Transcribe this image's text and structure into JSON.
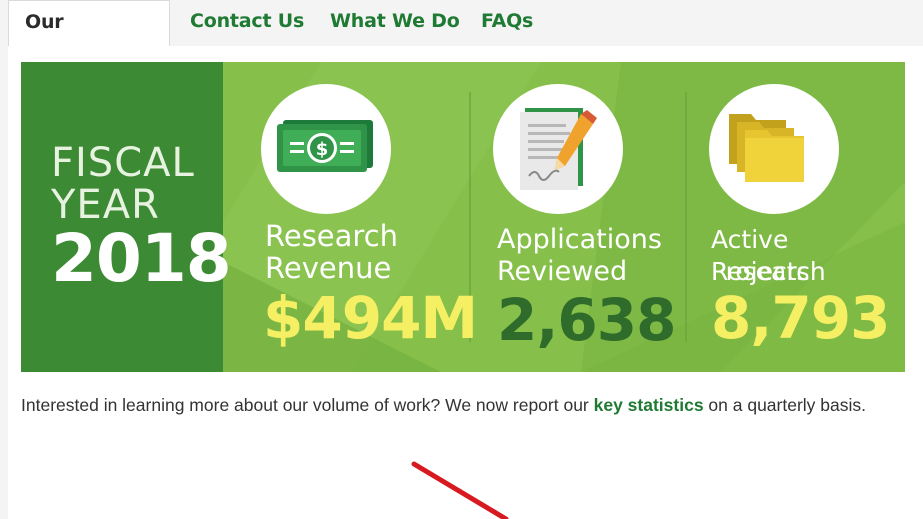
{
  "tabs": [
    {
      "label": "Our Statistics",
      "active": true
    },
    {
      "label": "Contact Us",
      "active": false
    },
    {
      "label": "What We Do",
      "active": false
    },
    {
      "label": "FAQs",
      "active": false
    }
  ],
  "banner": {
    "fiscal_line1": "FISCAL",
    "fiscal_line2": "YEAR",
    "year": "2018",
    "stats": [
      {
        "label_line1": "Research",
        "label_line2": "Revenue",
        "value": "$494M",
        "icon": "money-icon",
        "value_color": "#f4ef63"
      },
      {
        "label_line1": "Applications",
        "label_line2": "Reviewed",
        "value": "2,638",
        "icon": "document-pencil-icon",
        "value_color": "#2f6b2a"
      },
      {
        "label_line1": "Active Research",
        "label_line2": "Projects",
        "value": "8,793",
        "icon": "folders-icon",
        "value_color": "#f4ef63"
      }
    ]
  },
  "body": {
    "text_before": "Interested in learning more about our volume of work? We now report our ",
    "link_text": "key statistics",
    "text_after": " on a quarterly basis."
  },
  "colors": {
    "banner_green": "#7fba45",
    "dark_green": "#3c8a33",
    "tab_green": "#1f7a34",
    "accent_yellow": "#f4ef63",
    "arrow_red": "#d71920"
  }
}
